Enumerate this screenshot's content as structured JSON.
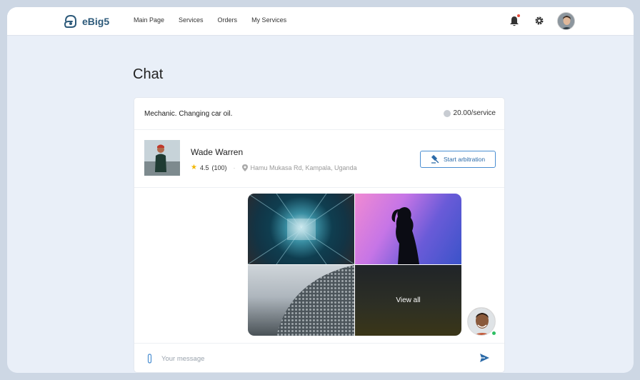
{
  "header": {
    "logo_text": "eBig5",
    "nav": [
      "Main Page",
      "Services",
      "Orders",
      "My Services"
    ],
    "icons": [
      "bell-icon",
      "gear-icon",
      "avatar"
    ]
  },
  "page": {
    "title": "Chat"
  },
  "service": {
    "title": "Mechanic. Changing car oil.",
    "price": "20.00/service"
  },
  "profile": {
    "name": "Wade Warren",
    "rating": "4.5",
    "reviews": "(100)",
    "address": "Hamu Mukasa Rd, Kampala, Uganda",
    "arbitration_label": "Start arbitration"
  },
  "gallery": {
    "view_all_label": "View all"
  },
  "composer": {
    "placeholder": "Your message"
  },
  "colors": {
    "accent": "#2b6aa8",
    "online": "#2fbf64",
    "notification": "#e74c3c",
    "star": "#f2b705"
  }
}
